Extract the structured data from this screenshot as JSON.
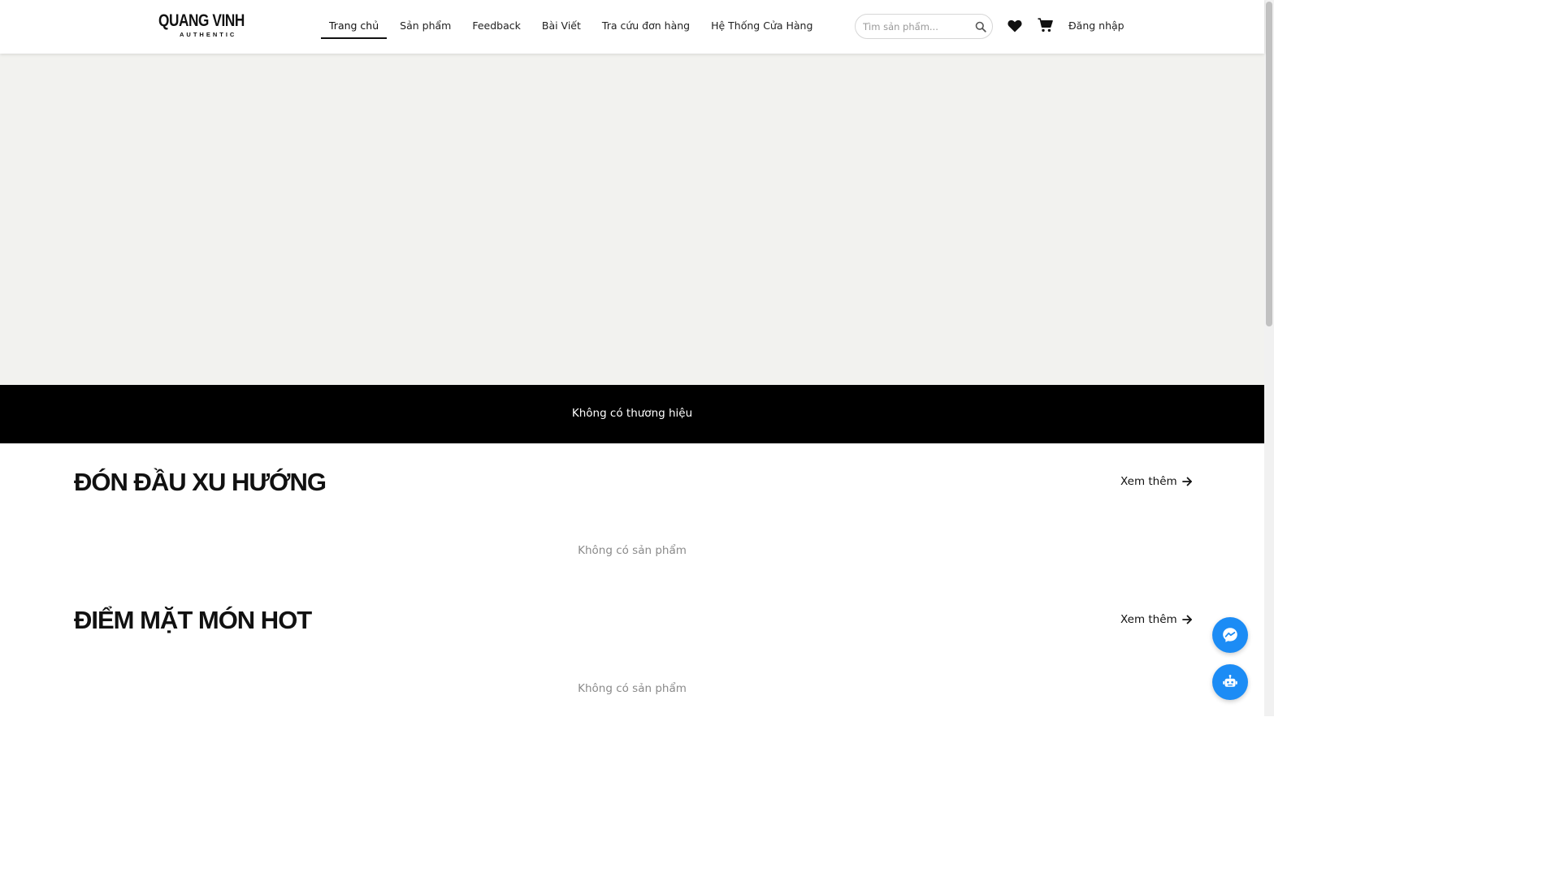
{
  "header": {
    "logo": {
      "main": "QUANG VINH",
      "sub": "AUTHENTIC"
    },
    "nav": [
      {
        "label": "Trang chủ",
        "active": true
      },
      {
        "label": "Sản phẩm"
      },
      {
        "label": "Feedback"
      },
      {
        "label": "Bài Viết"
      },
      {
        "label": "Tra cứu đơn hàng"
      },
      {
        "label": "Hệ Thống Cửa Hàng"
      }
    ],
    "search": {
      "placeholder": "Tìm sản phẩm...",
      "value": "",
      "icon": "search-icon"
    },
    "wishlist_icon": "heart-icon",
    "cart_icon": "cart-icon",
    "login_label": "Đăng nhập"
  },
  "brand_strip": {
    "text": "Không có thương hiệu"
  },
  "sections": [
    {
      "title": "ĐÓN ĐẦU XU HƯỚNG",
      "see_more": "Xem thêm",
      "empty": "Không có sản phẩm"
    },
    {
      "title": "ĐIỂM MẶT MÓN HOT",
      "see_more": "Xem thêm",
      "empty": "Không có sản phẩm"
    }
  ],
  "floating": {
    "messenger_icon": "messenger-icon",
    "chatbot_icon": "robot-icon"
  },
  "colors": {
    "accent": "#1c8cf5",
    "hero_bg": "#f2f2ef",
    "strip_bg": "#000000"
  }
}
